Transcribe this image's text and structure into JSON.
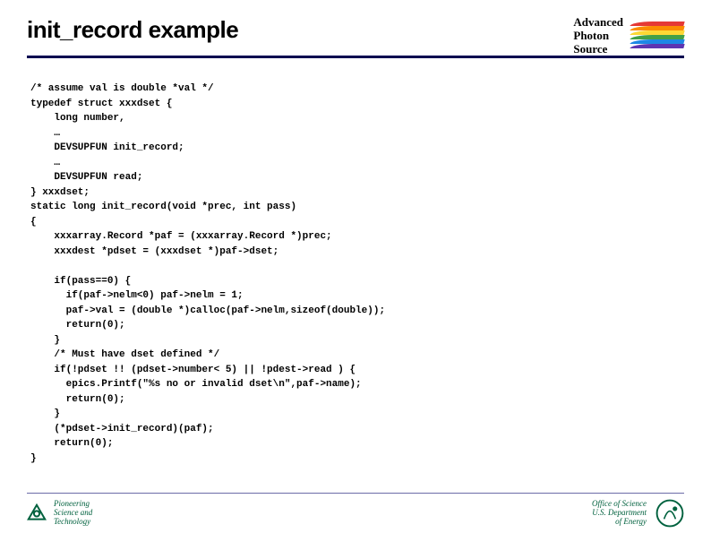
{
  "title": "init_record example",
  "aps_logo": {
    "line1": "Advanced",
    "line2": "Photon",
    "line3": "Source"
  },
  "code": "/* assume val is double *val */\ntypedef struct xxxdset {\n    long number,\n    …\n    DEVSUPFUN init_record;\n    …\n    DEVSUPFUN read;\n} xxxdset;\nstatic long init_record(void *prec, int pass)\n{\n    xxxarray.Record *paf = (xxxarray.Record *)prec;\n    xxxdest *pdset = (xxxdset *)paf->dset;\n\n    if(pass==0) {\n      if(paf->nelm<0) paf->nelm = 1;\n      paf->val = (double *)calloc(paf->nelm,sizeof(double));\n      return(0);\n    }\n    /* Must have dset defined */\n    if(!pdset !! (pdset->number< 5) || !pdest->read ) {\n      epics.Printf(\"%s no or invalid dset\\n\",paf->name);\n      return(0);\n    }\n    (*pdset->init_record)(paf);\n    return(0);\n}",
  "footer": {
    "left": {
      "line1": "Pioneering",
      "line2": "Science and",
      "line3": "Technology"
    },
    "right": {
      "line1": "Office of Science",
      "line2": "U.S. Department",
      "line3": "of Energy"
    }
  },
  "colors": {
    "rule": "#000050",
    "green": "#00613e",
    "rainbow": [
      "#e53935",
      "#fb8c00",
      "#fdd835",
      "#43a047",
      "#1e88e5",
      "#5e35b1"
    ]
  }
}
